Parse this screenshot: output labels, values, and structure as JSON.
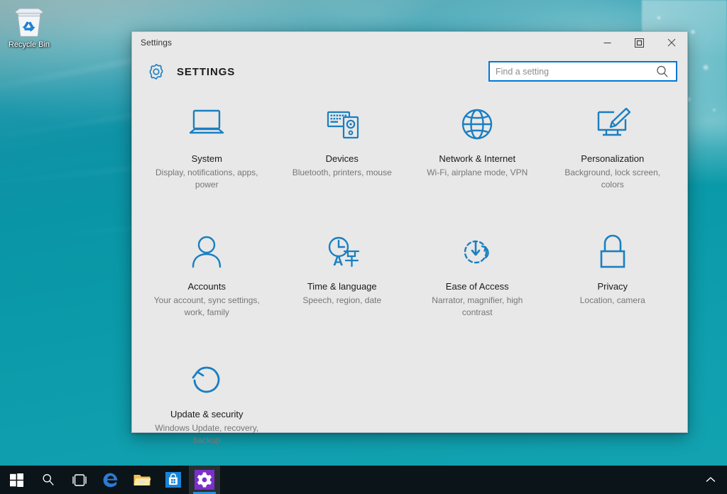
{
  "desktop": {
    "icons": [
      {
        "name": "recycle-bin",
        "label": "Recycle Bin"
      }
    ],
    "wallpaper_colors": {
      "deep_teal": "#0a95a6",
      "light_teal": "#12a3b1",
      "top_haze": "#7fa9ad"
    }
  },
  "window": {
    "title": "Settings",
    "controls": {
      "minimize": "Minimize",
      "maximize": "Maximize",
      "close": "Close"
    },
    "header": {
      "gear_icon": "gear-icon",
      "heading": "SETTINGS"
    },
    "search": {
      "placeholder": "Find a setting",
      "value": "",
      "icon": "search-icon",
      "border_color": "#0078d7"
    },
    "accent_color": "#0078d7",
    "background_color": "#e8e8e8",
    "tiles": [
      {
        "icon": "laptop-icon",
        "name": "System",
        "desc": "Display, notifications, apps, power"
      },
      {
        "icon": "keyboard-speaker-icon",
        "name": "Devices",
        "desc": "Bluetooth, printers, mouse"
      },
      {
        "icon": "globe-icon",
        "name": "Network & Internet",
        "desc": "Wi-Fi, airplane mode, VPN"
      },
      {
        "icon": "monitor-brush-icon",
        "name": "Personalization",
        "desc": "Background, lock screen, colors"
      },
      {
        "icon": "person-icon",
        "name": "Accounts",
        "desc": "Your account, sync settings, work, family"
      },
      {
        "icon": "clock-language-icon",
        "name": "Time & language",
        "desc": "Speech, region, date"
      },
      {
        "icon": "ease-of-access-icon",
        "name": "Ease of Access",
        "desc": "Narrator, magnifier, high contrast"
      },
      {
        "icon": "padlock-icon",
        "name": "Privacy",
        "desc": "Location, camera"
      },
      {
        "icon": "refresh-circle-icon",
        "name": "Update & security",
        "desc": "Windows Update, recovery, backup"
      }
    ]
  },
  "taskbar": {
    "items": [
      {
        "icon": "windows-start-icon",
        "label": "Start",
        "active": false
      },
      {
        "icon": "search-icon",
        "label": "Search",
        "active": false
      },
      {
        "icon": "task-view-icon",
        "label": "Task View",
        "active": false
      },
      {
        "icon": "edge-icon",
        "label": "Microsoft Edge",
        "active": false
      },
      {
        "icon": "folder-icon",
        "label": "File Explorer",
        "active": false
      },
      {
        "icon": "store-icon",
        "label": "Store",
        "active": false
      },
      {
        "icon": "settings-gear-icon",
        "label": "Settings",
        "active": true
      }
    ],
    "tray": [
      {
        "icon": "chevron-up-icon",
        "label": "Show hidden icons"
      }
    ],
    "background_color": "#0b1418"
  }
}
